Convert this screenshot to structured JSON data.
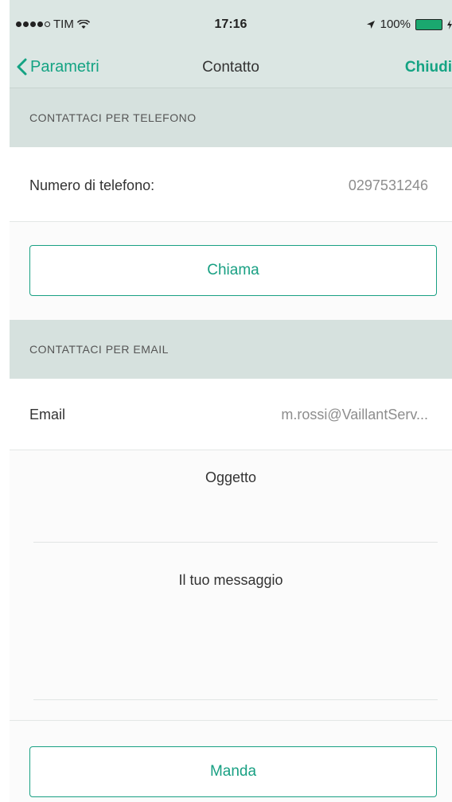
{
  "status_bar": {
    "carrier": "TIM",
    "time": "17:16",
    "battery": "100%",
    "battery_level": 1.0,
    "signal_bars": 4,
    "icons": [
      "wifi-icon",
      "location-arrow-icon",
      "battery-icon",
      "charging-icon"
    ]
  },
  "nav": {
    "back_label": "Parametri",
    "title": "Contatto",
    "close_label": "Chiudi"
  },
  "phone_section": {
    "header": "CONTATTACI PER TELEFONO",
    "field_label": "Numero di telefono:",
    "field_value": "0297531246",
    "call_button": "Chiama"
  },
  "email_section": {
    "header": "CONTATTACI PER EMAIL",
    "field_label": "Email",
    "field_value": "m.rossi@VaillantServ...",
    "subject_placeholder": "Oggetto",
    "message_placeholder": "Il tuo messaggio",
    "send_button": "Manda"
  },
  "colors": {
    "accent": "#14a383",
    "header_bg": "#dbe6e3",
    "section_bg": "#d6e1de"
  }
}
